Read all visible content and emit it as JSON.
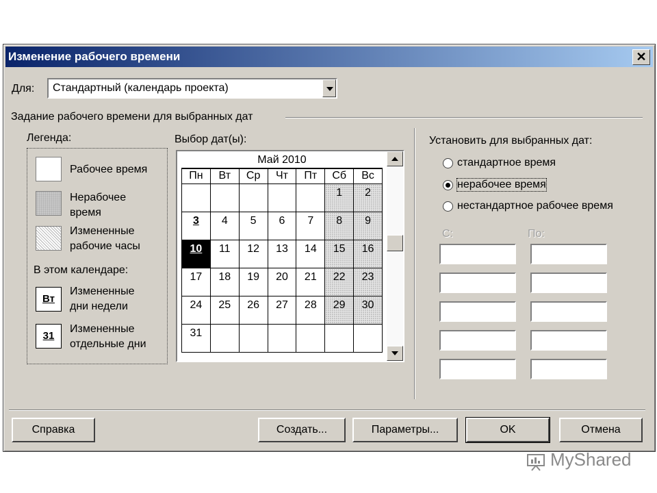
{
  "window": {
    "title": "Изменение рабочего времени",
    "close_glyph": "✕"
  },
  "for_label": "Для:",
  "for_value": "Стандартный (календарь проекта)",
  "group_title": "Задание рабочего времени для выбранных дат",
  "legend": {
    "title": "Легенда:",
    "working": "Рабочее время",
    "nonworking": [
      "Нерабочее",
      "время"
    ],
    "changed": [
      "Измененные",
      "рабочие часы"
    ],
    "in_calendar": "В этом календаре:",
    "changed_weekdays_icon": "Вт",
    "changed_weekdays": [
      "Измененные",
      "дни недели"
    ],
    "changed_days_icon": "31",
    "changed_days": [
      "Измененные",
      "отдельные дни"
    ]
  },
  "calendar": {
    "label": "Выбор дат(ы):",
    "month": "Май 2010",
    "weekdays": [
      "Пн",
      "Вт",
      "Ср",
      "Чт",
      "Пт",
      "Сб",
      "Вс"
    ],
    "weeks": [
      [
        "",
        "",
        "",
        "",
        "",
        "1",
        "2"
      ],
      [
        "3",
        "4",
        "5",
        "6",
        "7",
        "8",
        "9"
      ],
      [
        "10",
        "11",
        "12",
        "13",
        "14",
        "15",
        "16"
      ],
      [
        "17",
        "18",
        "19",
        "20",
        "21",
        "22",
        "23"
      ],
      [
        "24",
        "25",
        "26",
        "27",
        "28",
        "29",
        "30"
      ],
      [
        "31",
        "",
        "",
        "",
        "",
        "",
        ""
      ]
    ],
    "selected_day": "10",
    "bold_days": [
      "3"
    ]
  },
  "set_for_dates": {
    "title": "Установить для выбранных дат:",
    "options": [
      "стандартное время",
      "нерабочее время",
      "нестандартное рабочее время"
    ],
    "selected_index": 1,
    "from_label": "С:",
    "to_label": "По:"
  },
  "buttons": {
    "help": "Справка",
    "create": "Создать...",
    "options": "Параметры...",
    "ok": "OK",
    "cancel": "Отмена"
  },
  "watermark": "MyShared"
}
